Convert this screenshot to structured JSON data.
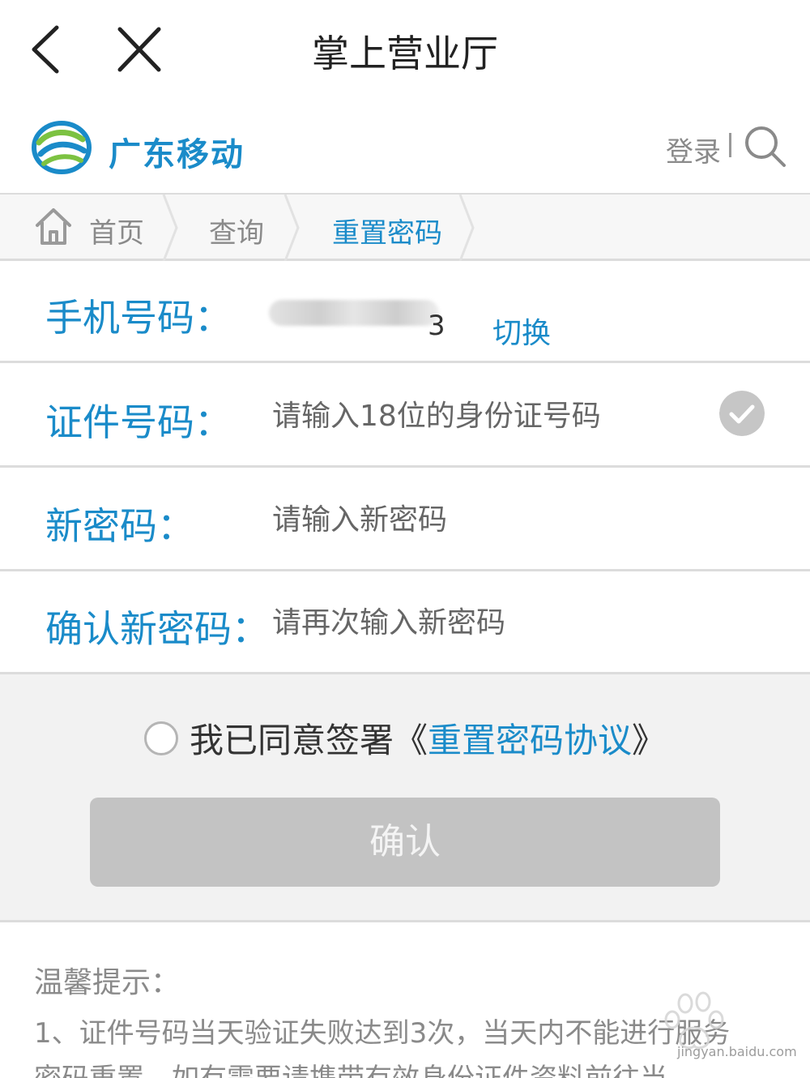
{
  "topbar": {
    "title": "掌上营业厅",
    "back_icon": "chevron-left-icon",
    "close_icon": "close-icon"
  },
  "brand": {
    "name": "广东移动",
    "logo_icon": "china-mobile-logo",
    "login_label": "登录",
    "search_icon": "search-icon",
    "color": "#1a8bc9"
  },
  "breadcrumb": {
    "items": [
      {
        "label": "首页",
        "icon": "home-icon"
      },
      {
        "label": "查询"
      },
      {
        "label": "重置密码"
      }
    ]
  },
  "form": {
    "phone": {
      "label": "手机号码：",
      "value_tail": "3",
      "switch_label": "切换"
    },
    "id_number": {
      "label": "证件号码：",
      "placeholder": "请输入18位的身份证号码",
      "check_icon": "check-circle-icon"
    },
    "new_password": {
      "label": "新密码：",
      "placeholder": "请输入新密码"
    },
    "confirm_password": {
      "label": "确认新密码：",
      "placeholder": "请再次输入新密码"
    }
  },
  "agreement": {
    "text": "我已同意签署",
    "link_open": "《",
    "link_text": "重置密码协议",
    "link_close": "》"
  },
  "confirm_button": {
    "label": "确认"
  },
  "tips": {
    "title": "温馨提示：",
    "line1": "1、证件号码当天验证失败达到3次，当天内不能进行服务",
    "line2": "密码重置，如有需要请携带有效身份证件资料前往当"
  },
  "watermark": {
    "text": "jingyan.baidu.com"
  },
  "colors": {
    "accent": "#1a8bc9",
    "disabled_button": "#c3c3c3",
    "divider": "#dcdcdc"
  }
}
